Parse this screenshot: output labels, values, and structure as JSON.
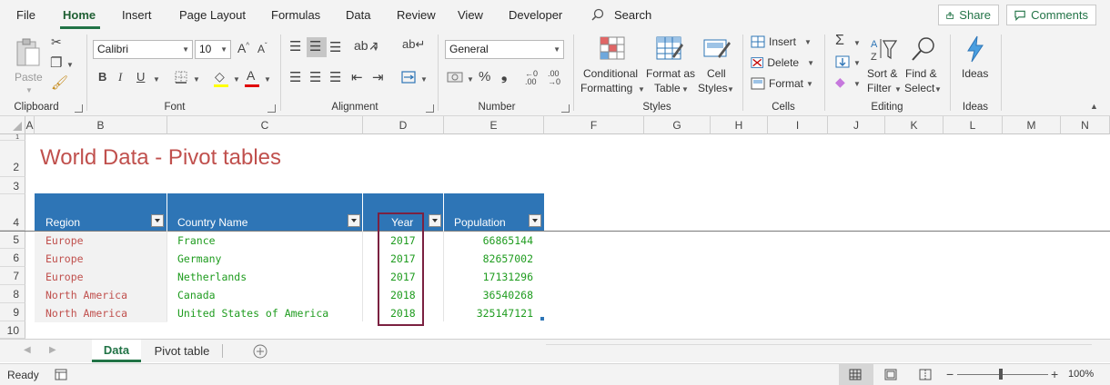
{
  "menu": {
    "tabs": [
      "File",
      "Home",
      "Insert",
      "Page Layout",
      "Formulas",
      "Data",
      "Review",
      "View",
      "Developer"
    ],
    "search_label": "Search",
    "share_label": "Share",
    "comments_label": "Comments"
  },
  "ribbon": {
    "clipboard": {
      "paste_label": "Paste",
      "group_label": "Clipboard"
    },
    "font": {
      "name": "Calibri",
      "size": "10",
      "group_label": "Font"
    },
    "alignment": {
      "group_label": "Alignment"
    },
    "number": {
      "format": "General",
      "group_label": "Number"
    },
    "styles": {
      "conditional_1": "Conditional",
      "conditional_2": "Formatting",
      "format_table_1": "Format as",
      "format_table_2": "Table",
      "cell_styles_1": "Cell",
      "cell_styles_2": "Styles",
      "group_label": "Styles"
    },
    "cells": {
      "insert": "Insert",
      "delete": "Delete",
      "format": "Format",
      "group_label": "Cells"
    },
    "editing": {
      "sort_1": "Sort &",
      "sort_2": "Filter",
      "find_1": "Find &",
      "find_2": "Select",
      "group_label": "Editing"
    },
    "ideas": {
      "label": "Ideas",
      "group_label": "Ideas"
    }
  },
  "grid": {
    "columns": [
      "A",
      "B",
      "C",
      "D",
      "E",
      "F",
      "G",
      "H",
      "I",
      "J",
      "K",
      "L",
      "M",
      "N"
    ],
    "rows": [
      "1",
      "2",
      "3",
      "4",
      "5",
      "6",
      "7",
      "8",
      "9",
      "10"
    ],
    "title": "World Data - Pivot tables",
    "table": {
      "headers": [
        "Region",
        "Country Name",
        "Year",
        "Population"
      ],
      "rows": [
        [
          "Europe",
          "France",
          "2017",
          "66865144"
        ],
        [
          "Europe",
          "Germany",
          "2017",
          "82657002"
        ],
        [
          "Europe",
          "Netherlands",
          "2017",
          "17131296"
        ],
        [
          "North America",
          "Canada",
          "2018",
          "36540268"
        ],
        [
          "North America",
          "United States of America",
          "2018",
          "325147121"
        ]
      ]
    }
  },
  "sheets": {
    "tabs": [
      "Data",
      "Pivot table"
    ],
    "active": "Data"
  },
  "status": {
    "ready": "Ready",
    "zoom": "100%"
  },
  "colors": {
    "accent": "#217346",
    "table_header": "#2e75b6",
    "title": "#c0504d",
    "highlight_border": "#7b2141"
  }
}
